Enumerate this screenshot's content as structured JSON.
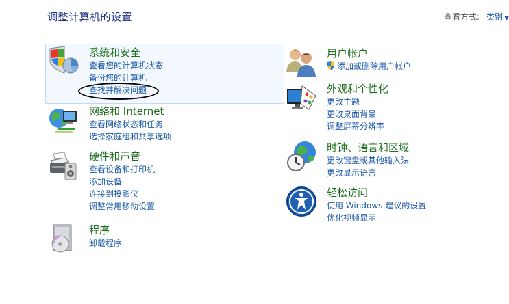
{
  "title": "调整计算机的设置",
  "view_by": {
    "label": "查看方式:",
    "value": "类别"
  },
  "left": [
    {
      "heading": "系统和安全",
      "icon": "shield-flag-icon",
      "links": [
        "查看您的计算机状态",
        "备份您的计算机",
        "查找并解决问题"
      ]
    },
    {
      "heading": "网络和 Internet",
      "icon": "globe-network-icon",
      "links": [
        "查看网络状态和任务",
        "选择家庭组和共享选项"
      ]
    },
    {
      "heading": "硬件和声音",
      "icon": "printer-speaker-icon",
      "links": [
        "查看设备和打印机",
        "添加设备",
        "连接到投影仪",
        "调整常用移动设置"
      ]
    },
    {
      "heading": "程序",
      "icon": "programs-disc-icon",
      "links": [
        "卸载程序"
      ]
    }
  ],
  "right": [
    {
      "heading": "用户帐户",
      "icon": "users-icon",
      "links": [
        "添加或删除用户帐户"
      ]
    },
    {
      "heading": "外观和个性化",
      "icon": "monitor-palette-icon",
      "links": [
        "更改主题",
        "更改桌面背景",
        "调整屏幕分辨率"
      ]
    },
    {
      "heading": "时钟、语言和区域",
      "icon": "clock-globe-icon",
      "links": [
        "更改键盘或其他输入法",
        "更改显示语言"
      ]
    },
    {
      "heading": "轻松访问",
      "icon": "ease-of-access-icon",
      "links": [
        "使用 Windows 建议的设置",
        "优化视频显示"
      ]
    }
  ]
}
